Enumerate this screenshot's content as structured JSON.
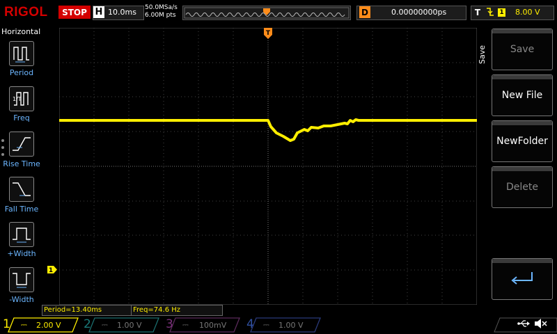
{
  "topbar": {
    "logo": "RIGOL",
    "run_state": "STOP",
    "h_letter": "H",
    "timebase": "10.0ms",
    "sample_rate": "50.0MSa/s",
    "memory_depth": "6.00M pts",
    "delay_letter": "D",
    "delay_value": "0.00000000ps",
    "trigger_letter": "T",
    "trigger_channel": "1",
    "trigger_level": "8.00 V"
  },
  "left_menu": {
    "title": "Horizontal",
    "items": [
      {
        "label": "Period",
        "icon": "period-icon"
      },
      {
        "label": "Freq",
        "icon": "freq-icon"
      },
      {
        "label": "Rise Time",
        "icon": "rise-time-icon"
      },
      {
        "label": "Fall Time",
        "icon": "fall-time-icon"
      },
      {
        "label": "+Width",
        "icon": "pos-width-icon"
      },
      {
        "label": "-Width",
        "icon": "neg-width-icon"
      }
    ]
  },
  "right_menu": {
    "title": "Save",
    "items": [
      {
        "label": "Save",
        "enabled": false
      },
      {
        "label": "New File",
        "enabled": true
      },
      {
        "label": "NewFolder",
        "enabled": true
      },
      {
        "label": "Delete",
        "enabled": false
      }
    ],
    "enter_icon": "enter-return-icon"
  },
  "measurements": {
    "period": "Period=13.40ms",
    "freq": "Freq=74.6 Hz"
  },
  "channels": [
    {
      "num": "1",
      "scale": "2.00 V",
      "active": true,
      "color": "#ffee00"
    },
    {
      "num": "2",
      "scale": "1.00 V",
      "active": false,
      "color": "#00a0a0"
    },
    {
      "num": "3",
      "scale": "100mV",
      "active": false,
      "color": "#c040c0"
    },
    {
      "num": "4",
      "scale": "1.00 V",
      "active": false,
      "color": "#2060ff"
    }
  ],
  "markers": {
    "trigger_marker": "T",
    "ch1_ground_marker": "1"
  },
  "status_icons": [
    "usb-icon",
    "speaker-muted-icon"
  ],
  "colors": {
    "trace": "#ffee00",
    "accent_red": "#d40000",
    "trigger_orange": "#ff8c1a",
    "menu_label": "#6cb6ff"
  }
}
